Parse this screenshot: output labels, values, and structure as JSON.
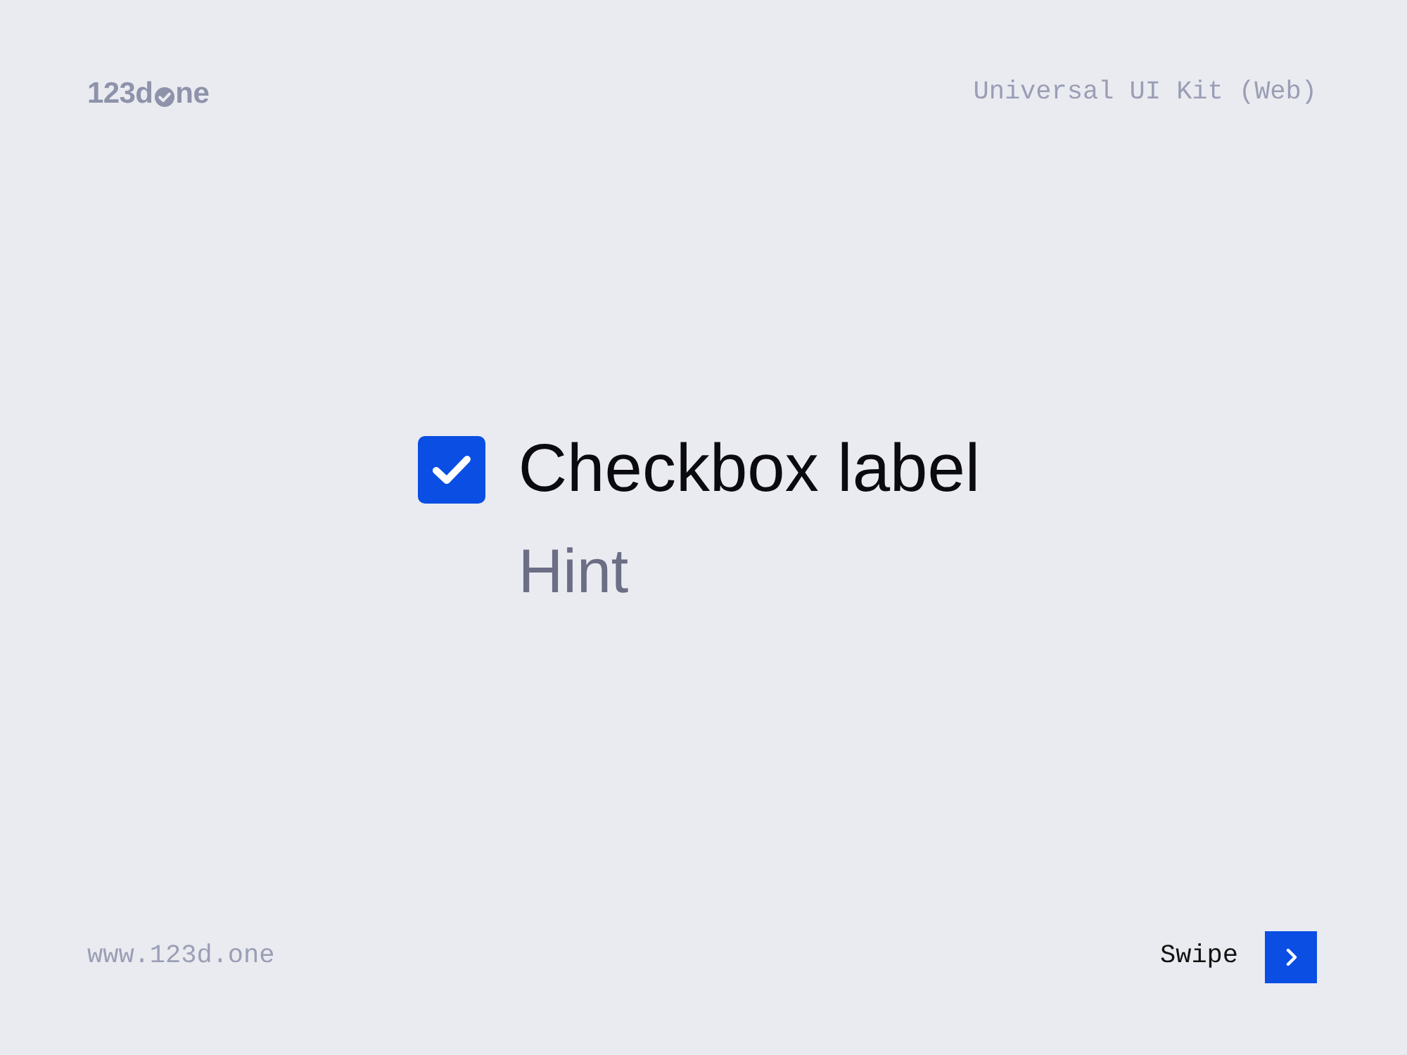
{
  "header": {
    "logo": {
      "text_before_mark": "123d",
      "text_after_mark": "ne"
    },
    "kit_title": "Universal UI Kit (Web)"
  },
  "checkbox": {
    "checked": true,
    "label": "Checkbox label",
    "hint": "Hint"
  },
  "footer": {
    "website": "www.123d.one",
    "swipe_label": "Swipe"
  }
}
